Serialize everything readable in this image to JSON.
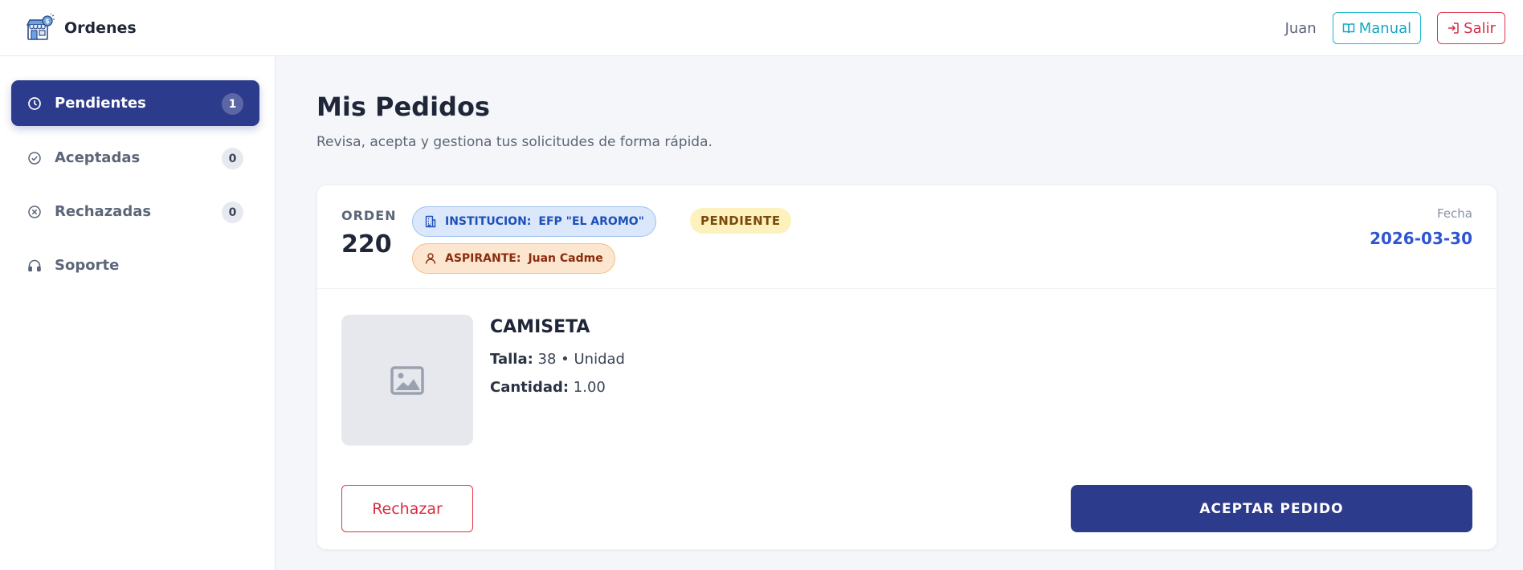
{
  "header": {
    "app_name": "Ordenes",
    "logo_icon": "store-icon",
    "username": "Juan",
    "manual_label": "Manual",
    "logout_label": "Salir"
  },
  "sidebar": {
    "items": [
      {
        "label": "Pendientes",
        "icon": "clock-icon",
        "badge": "1",
        "active": true
      },
      {
        "label": "Aceptadas",
        "icon": "check-circle-icon",
        "badge": "0",
        "active": false
      },
      {
        "label": "Rechazadas",
        "icon": "x-circle-icon",
        "badge": "0",
        "active": false
      },
      {
        "label": "Soporte",
        "icon": "headphones-icon",
        "active": false
      }
    ]
  },
  "main": {
    "title": "Mis Pedidos",
    "subtitle": "Revisa, acepta y gestiona tus solicitudes de forma rápida.",
    "order": {
      "label": "ORDEN",
      "number": "220",
      "institution_key": "INSTITUCION:",
      "institution_value": "EFP \"EL AROMO\"",
      "aspirant_key": "ASPIRANTE:",
      "aspirant_value": "Juan Cadme",
      "status": "PENDIENTE",
      "date_label": "Fecha",
      "date_value": "2026-03-30",
      "product": {
        "name": "CAMISETA",
        "size_label": "Talla:",
        "size_value": "38 • Unidad",
        "quantity_label": "Cantidad:",
        "quantity_value": "1.00"
      },
      "reject_label": "Rechazar",
      "accept_label": "ACEPTAR PEDIDO"
    }
  },
  "colors": {
    "primary": "#2d3b8c",
    "accent_cyan": "#1ab6cf",
    "danger": "#e03548",
    "date_blue": "#2f56d2",
    "status_bg": "#fdf2bd"
  }
}
